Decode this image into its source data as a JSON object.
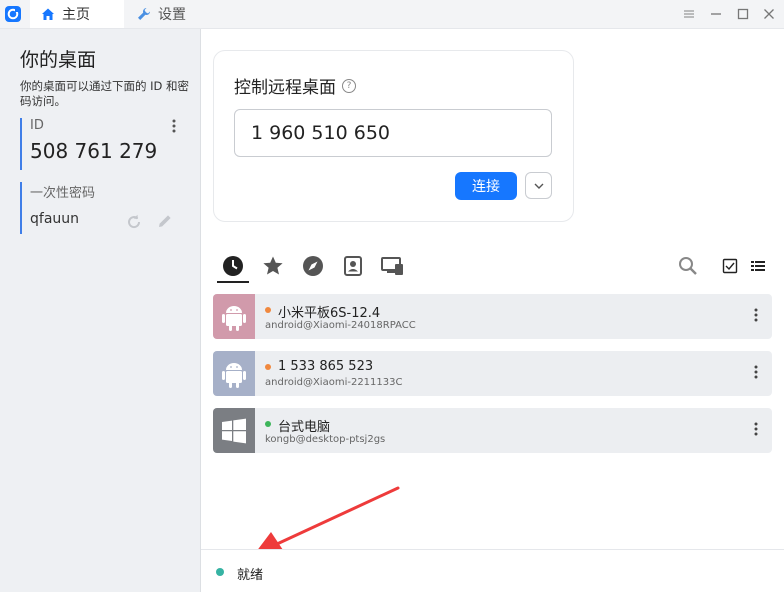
{
  "tabs": [
    {
      "label": "主页",
      "icon": "home-icon"
    },
    {
      "label": "设置",
      "icon": "wrench-icon"
    }
  ],
  "window_controls": [
    "menu-icon",
    "minimize-icon",
    "maximize-icon",
    "close-icon"
  ],
  "sidebar": {
    "title": "你的桌面",
    "description": "你的桌面可以通过下面的 ID 和密码访问。",
    "id_label": "ID",
    "id_value": "508 761 279",
    "password_label": "一次性密码",
    "password_value": "qfauun"
  },
  "control": {
    "title": "控制远程桌面",
    "remote_id_value": "1 960 510 650",
    "connect_label": "连接"
  },
  "peer_tabs": [
    {
      "icon": "recent-clock-icon",
      "active": true
    },
    {
      "icon": "favorites-star-icon",
      "active": false
    },
    {
      "icon": "discovered-compass-icon",
      "active": false
    },
    {
      "icon": "address-book-icon",
      "active": false
    },
    {
      "icon": "group-devices-icon",
      "active": false
    }
  ],
  "peers": [
    {
      "name": "小米平板6S-12.4",
      "subtitle": "android@Xiaomi-24018RPACC",
      "platform": "android",
      "thumb_color": "#d19aab",
      "status_color": "#f0883e"
    },
    {
      "name": "1 533 865 523",
      "subtitle": "android@Xiaomi-2211133C",
      "platform": "android",
      "thumb_color": "#a6b0c8",
      "status_color": "#f0883e"
    },
    {
      "name": "台式电脑",
      "subtitle": "kongb@desktop-ptsj2gs",
      "platform": "windows",
      "thumb_color": "#7b7e83",
      "status_color": "#3db55a"
    }
  ],
  "status": {
    "text": "就绪",
    "color": "#36b3a3"
  },
  "colors": {
    "accent": "#1677ff",
    "sidebar_bg": "#eef0f3"
  }
}
